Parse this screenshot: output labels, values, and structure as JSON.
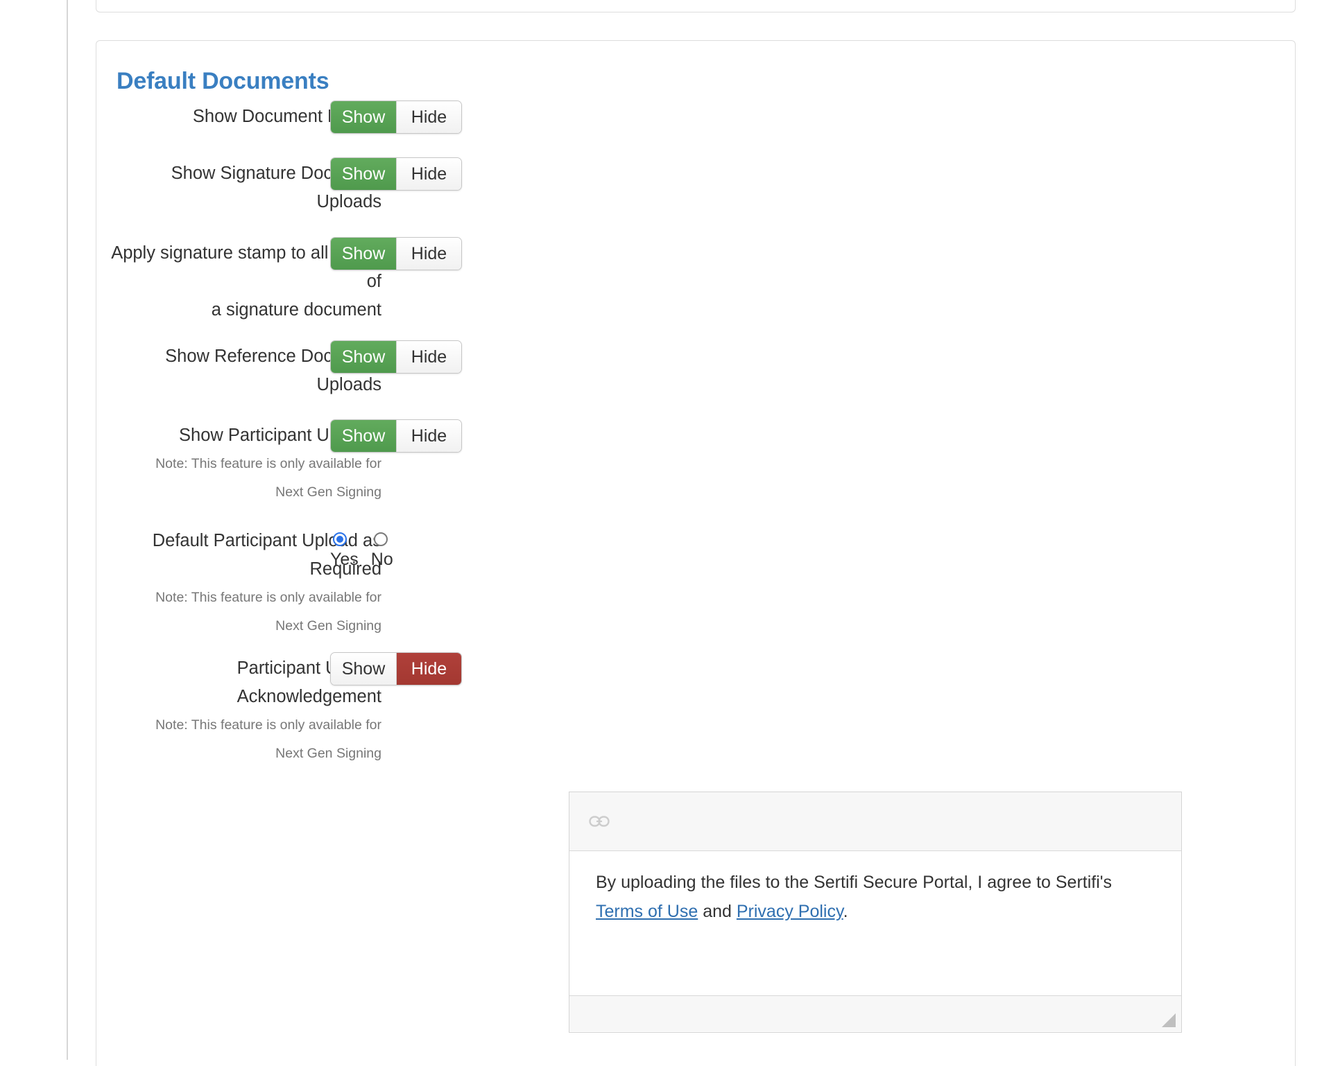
{
  "section": {
    "title": "Default Documents"
  },
  "rows": [
    {
      "label": "Show Document Library",
      "note1": "",
      "note2": "",
      "control": "toggle",
      "show_label": "Show",
      "hide_label": "Hide",
      "selected": "Show"
    },
    {
      "label": "Show Signature Document",
      "label2": "Uploads",
      "note1": "",
      "note2": "",
      "control": "toggle",
      "show_label": "Show",
      "hide_label": "Hide",
      "selected": "Show"
    },
    {
      "label": "Apply signature stamp to all pages",
      "label2": "of",
      "label3": "a signature document",
      "note1": "",
      "note2": "",
      "control": "toggle",
      "show_label": "Show",
      "hide_label": "Hide",
      "selected": "Show"
    },
    {
      "label": "Show Reference Document",
      "label2": "Uploads",
      "note1": "",
      "note2": "",
      "control": "toggle",
      "show_label": "Show",
      "hide_label": "Hide",
      "selected": "Show"
    },
    {
      "label": "Show Participant Uploads",
      "note1": "Note: This feature is only available for",
      "note2": "Next Gen Signing",
      "control": "toggle",
      "show_label": "Show",
      "hide_label": "Hide",
      "selected": "Show"
    },
    {
      "label": "Default Participant Upload as",
      "label2": "Required",
      "note1": "Note: This feature is only available for",
      "note2": "Next Gen Signing",
      "control": "radio",
      "yes_label": "Yes",
      "no_label": "No",
      "selected": "Yes"
    },
    {
      "label": "Participant Upload",
      "label2": "Acknowledgement",
      "note1": "Note: This feature is only available for",
      "note2": "Next Gen Signing",
      "control": "toggle",
      "show_label": "Show",
      "hide_label": "Hide",
      "selected": "Hide"
    }
  ],
  "editor": {
    "link_icon": "link-icon",
    "text_prefix": "By uploading the files to the Sertifi Secure Portal, I agree to Sertifi's ",
    "link_terms": "Terms of Use",
    "text_and": " and ",
    "link_privacy": "Privacy Policy",
    "text_suffix": "."
  },
  "colors": {
    "title_blue": "#3a7fc1",
    "toggle_green": "#4f9a4d",
    "toggle_red": "#a33831",
    "radio_blue": "#2a72e8",
    "link_blue": "#2f6fb0"
  }
}
